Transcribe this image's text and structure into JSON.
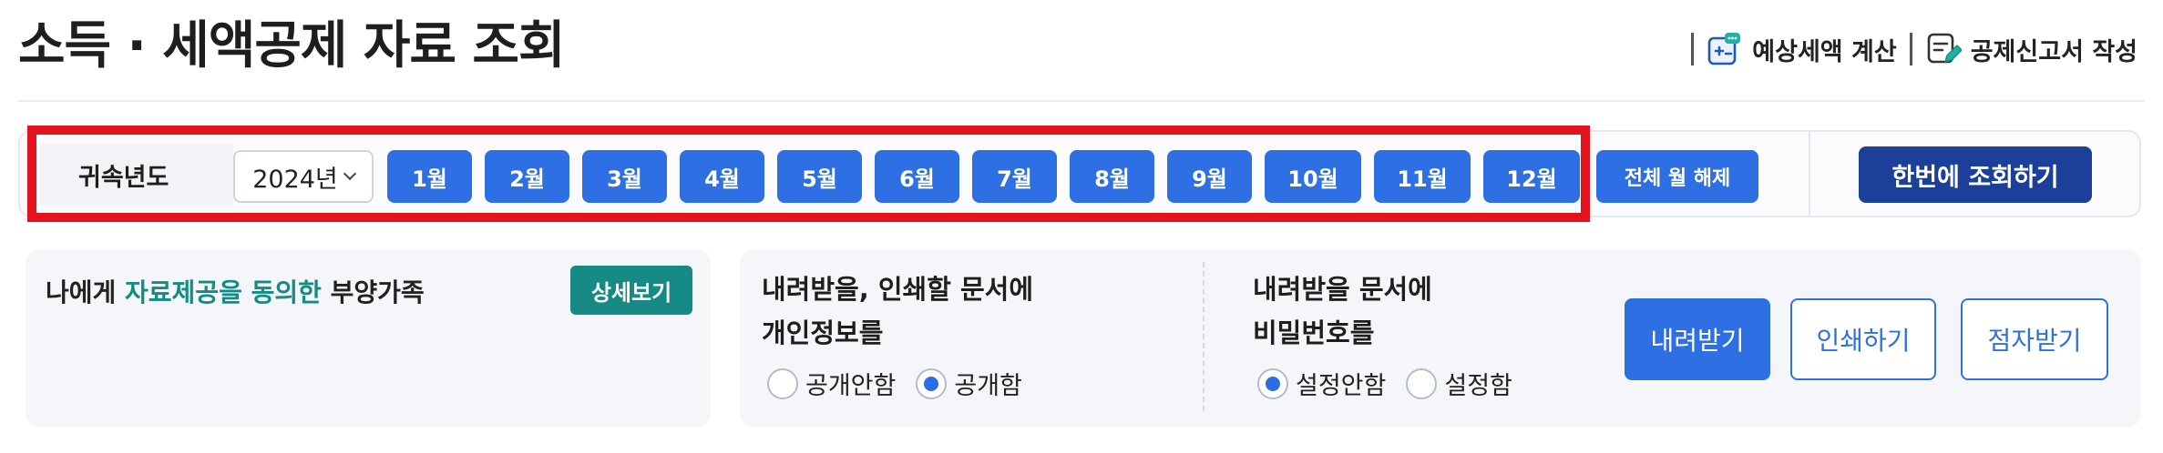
{
  "title": "소득 · 세액공제 자료 조회",
  "top_actions": [
    {
      "label": "예상세액 계산",
      "icon": "calculator-chat-icon"
    },
    {
      "label": "공제신고서 작성",
      "icon": "document-pencil-icon"
    }
  ],
  "filter": {
    "year_label": "귀속년도",
    "year_value": "2024년",
    "months": [
      "1월",
      "2월",
      "3월",
      "4월",
      "5월",
      "6월",
      "7월",
      "8월",
      "9월",
      "10월",
      "11월",
      "12월"
    ],
    "clear_all": "전체 월 해제",
    "lookup_all": "한번에 조회하기"
  },
  "dependents": {
    "prefix": "나에게 ",
    "highlight": "자료제공을 동의한",
    "suffix": " 부양가족",
    "detail_button": "상세보기"
  },
  "personal_info": {
    "title_line1": "내려받을, 인쇄할 문서에",
    "title_line2": "개인정보를",
    "options": [
      {
        "label": "공개안함",
        "checked": false
      },
      {
        "label": "공개함",
        "checked": true
      }
    ]
  },
  "password": {
    "title_line1": "내려받을 문서에",
    "title_line2": "비밀번호를",
    "options": [
      {
        "label": "설정안함",
        "checked": true
      },
      {
        "label": "설정함",
        "checked": false
      }
    ]
  },
  "actions": {
    "download": "내려받기",
    "print": "인쇄하기",
    "braille": "점자받기"
  },
  "colors": {
    "primary": "#2f6fe4",
    "dark_primary": "#1c3f9a",
    "teal": "#168a84",
    "highlight_teal": "#138c84",
    "annotation_red": "#e3121d"
  }
}
